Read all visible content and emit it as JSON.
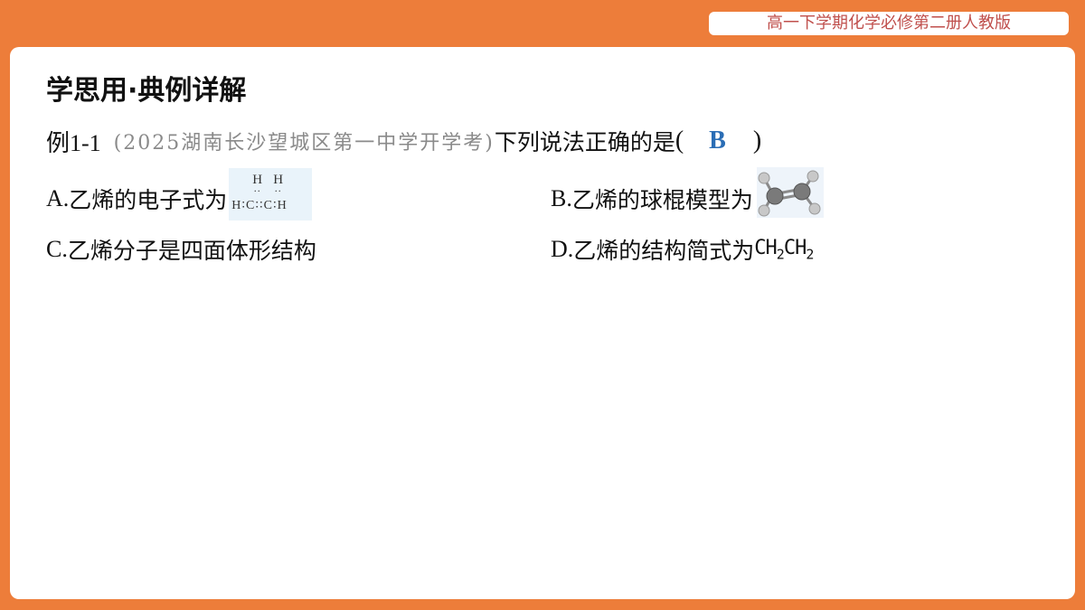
{
  "header": {
    "badge": "高一下学期化学必修第二册人教版"
  },
  "section": {
    "title": "学思用·典例详解"
  },
  "question": {
    "number": "例1-1",
    "source": "(2025湖南长沙望城区第一中学开学考)",
    "stem": "下列说法正确的是",
    "open_paren": "(",
    "answer": "B",
    "close_paren": ")"
  },
  "options": {
    "a": {
      "letter": "A.",
      "text": "乙烯的电子式为"
    },
    "b": {
      "letter": "B.",
      "text": "乙烯的球棍模型为"
    },
    "c": {
      "letter": "C.",
      "text": "乙烯分子是四面体形结构"
    },
    "d": {
      "letter": "D.",
      "text": "乙烯的结构简式为",
      "formula_1": "CH",
      "sub_1": "2",
      "formula_2": "CH",
      "sub_2": "2"
    }
  },
  "lewis": {
    "h_top_1": "H",
    "h_top_2": "H",
    "dots_1": "··",
    "dots_2": "··",
    "row": "H∶C∶∶C∶H"
  },
  "colors": {
    "frame": "#ed7d3a",
    "answer": "#2a6db5",
    "source": "#8a8a8a",
    "badge_text": "#c0504d"
  }
}
